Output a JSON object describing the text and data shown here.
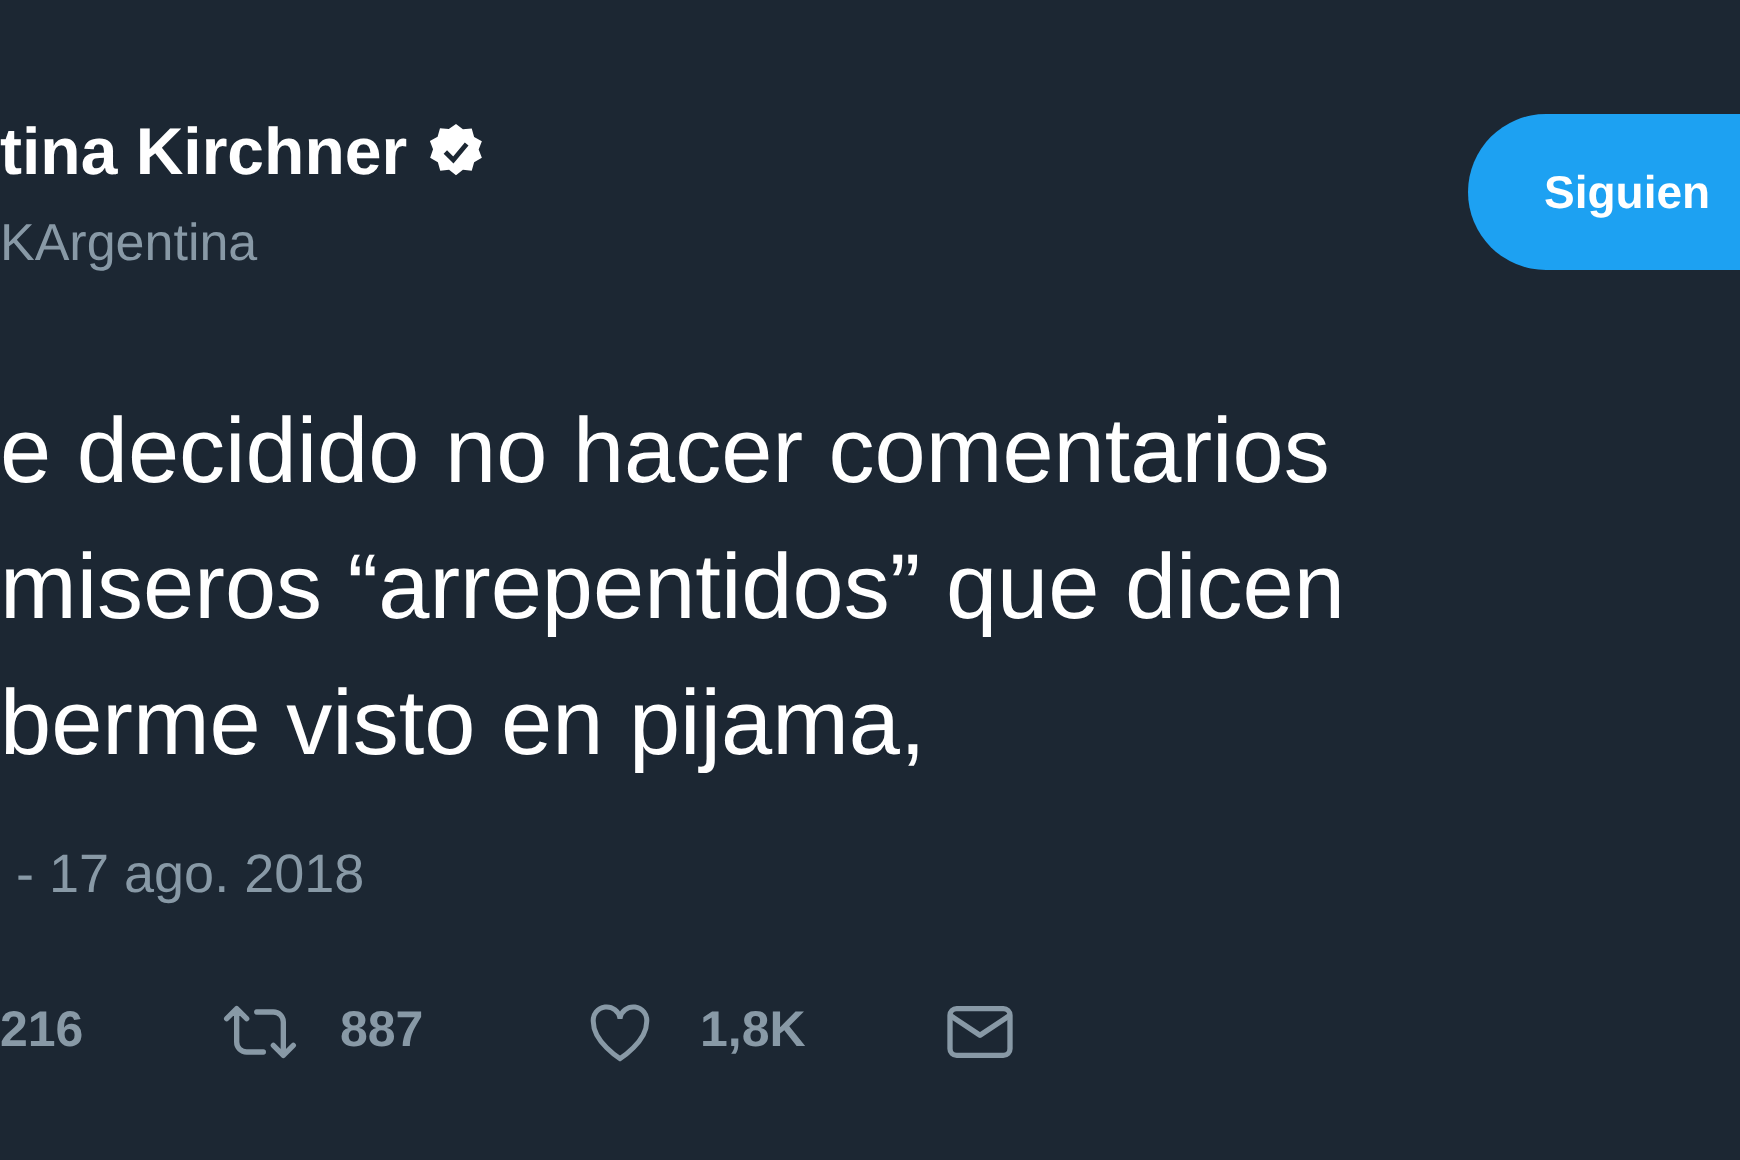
{
  "author": {
    "name": "tina Kirchner",
    "handle": "KArgentina",
    "verified": true
  },
  "follow_button": {
    "label": "Siguien"
  },
  "tweet": {
    "lines": [
      "e decidido no hacer comentarios",
      "miseros “arrepentidos” que dicen",
      "berme visto en pijama,"
    ],
    "date": "- 17 ago. 2018"
  },
  "actions": [
    {
      "kind": "reply",
      "count": "216"
    },
    {
      "kind": "retweet",
      "count": "887"
    },
    {
      "kind": "like",
      "count": "1,8K"
    },
    {
      "kind": "message"
    }
  ]
}
